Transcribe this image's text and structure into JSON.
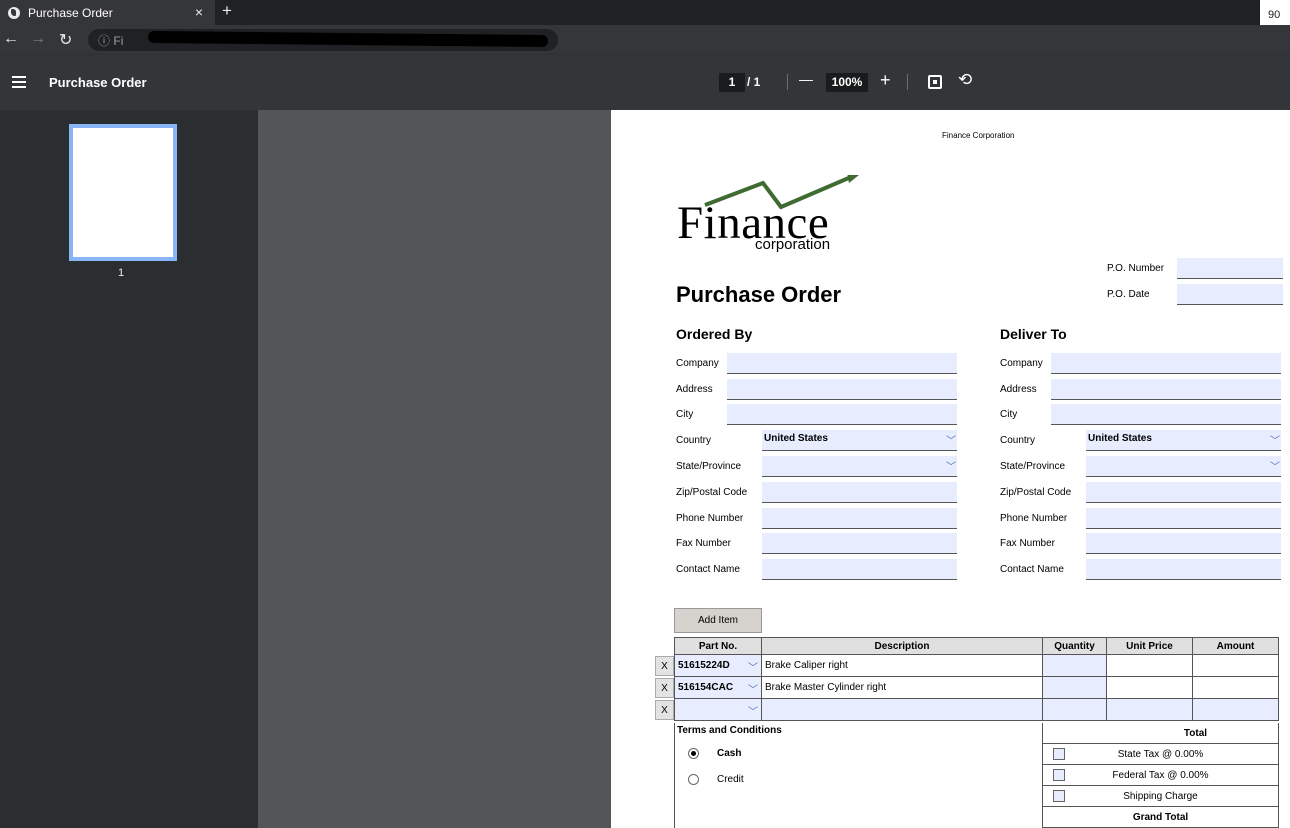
{
  "browser": {
    "tab_title": "Purchase Order",
    "tab_close": "×",
    "new_tab": "+",
    "zoom_chip": "90",
    "url_prefix": "Fi"
  },
  "pdf_toolbar": {
    "title": "Purchase Order",
    "current_page": "1",
    "total_pages": "/ 1",
    "zoom_out": "—",
    "zoom": "100%",
    "zoom_in": "+"
  },
  "sidebar": {
    "thumb_label": "1"
  },
  "doc": {
    "header": "Finance Corporation",
    "logo_word": "Finance",
    "logo_sub": "corporation",
    "title": "Purchase Order",
    "po_number_label": "P.O. Number",
    "po_date_label": "P.O. Date",
    "ordered_by": {
      "title": "Ordered By",
      "company": "Company",
      "address": "Address",
      "city": "City",
      "country": "Country",
      "country_value": "United States",
      "state": "State/Province",
      "zip": "Zip/Postal Code",
      "phone": "Phone Number",
      "fax": "Fax Number",
      "contact": "Contact Name"
    },
    "deliver_to": {
      "title": "Deliver To",
      "company": "Company",
      "address": "Address",
      "city": "City",
      "country": "Country",
      "country_value": "United States",
      "state": "State/Province",
      "zip": "Zip/Postal Code",
      "phone": "Phone Number",
      "fax": "Fax Number",
      "contact": "Contact Name"
    },
    "add_item": "Add Item",
    "table_headers": [
      "Part No.",
      "Description",
      "Quantity",
      "Unit Price",
      "Amount"
    ],
    "rows": [
      {
        "x": "X",
        "part": "51615224D",
        "desc": "Brake Caliper right"
      },
      {
        "x": "X",
        "part": "516154CAC",
        "desc": "Brake Master Cylinder right"
      },
      {
        "x": "X",
        "part": "",
        "desc": ""
      }
    ],
    "terms_title": "Terms and Conditions",
    "payment": {
      "cash": "Cash",
      "credit": "Credit",
      "selected": "Cash"
    },
    "totals": {
      "title": "Total",
      "state_tax": "State Tax @ 0.00%",
      "federal_tax": "Federal Tax @ 0.00%",
      "shipping": "Shipping Charge",
      "grand_total": "Grand Total"
    }
  }
}
